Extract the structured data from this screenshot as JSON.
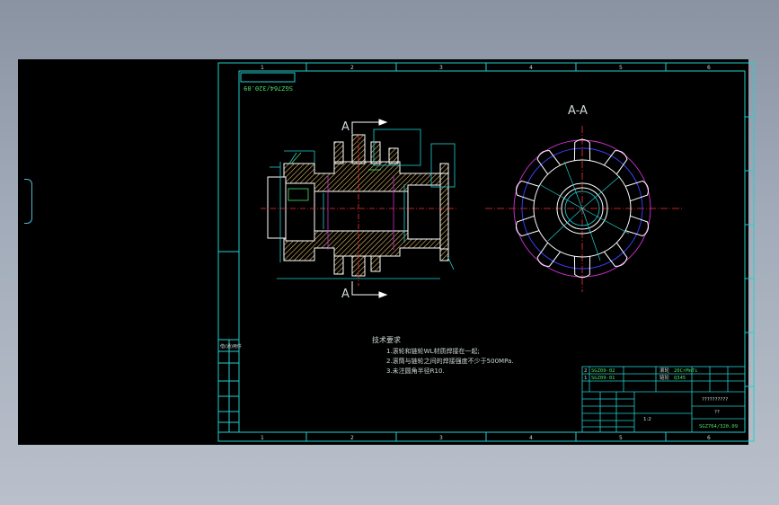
{
  "section_label": "A-A",
  "cut_label_top": "A",
  "cut_label_bottom": "A",
  "drawing_code": "SGZ764/320.09",
  "drawing_code_rotated": "SGZ764/320.09",
  "zone_numbers_top": [
    "1",
    "2",
    "3",
    "4",
    "5",
    "6",
    "7",
    "8"
  ],
  "zone_numbers_bottom": [
    "1",
    "2",
    "3",
    "4",
    "5",
    "6",
    "7",
    "8"
  ],
  "tech_req": {
    "title": "技术要求",
    "items": [
      "1.滚轮和链轮WL材质焊接在一起;",
      "2.滚筒与链轮之间的焊接强度不少于500MPa.",
      "3.未注圆角半径R10."
    ]
  },
  "parts_list": [
    {
      "no": "2",
      "code": "SGZ09-02",
      "name": "滚轮",
      "material": "20CrMnTi"
    },
    {
      "no": "1",
      "code": "SGZ09-01",
      "name": "链轮",
      "material": "Q345"
    }
  ],
  "title_block": {
    "title": "??????????",
    "subtitle": "??",
    "scale": "1:2",
    "code": "SGZ764/320.09"
  },
  "left_strip_labels": [
    "借(通)用件",
    "",
    "",
    "",
    "",
    "",
    ""
  ],
  "colors": {
    "border": "#22d0d0",
    "centerline": "#ff3030",
    "hatch": "#e8c26a",
    "outline": "#ffffff",
    "dim": "#4de06a",
    "addendum": "#d030d0",
    "pitch": "#4040ff"
  }
}
